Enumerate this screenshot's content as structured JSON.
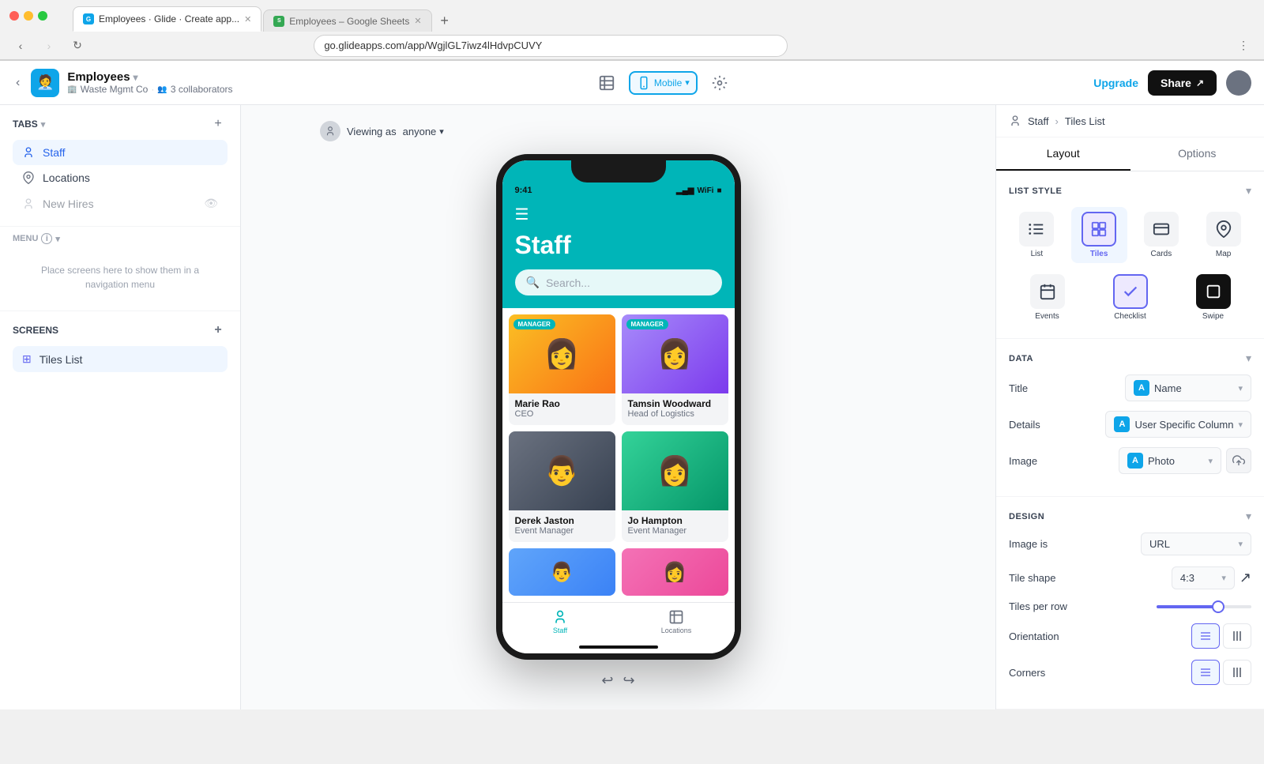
{
  "browser": {
    "tabs": [
      {
        "label": "Employees · Glide · Create app...",
        "type": "glide",
        "active": true
      },
      {
        "label": "Employees – Google Sheets",
        "type": "sheets",
        "active": false
      }
    ],
    "address": "go.glideapps.com/app/WgjlGL7iwz4lHdvpCUVY"
  },
  "header": {
    "app_name": "Employees",
    "app_subtitle_company": "Waste Mgmt Co",
    "app_subtitle_collab": "3 collaborators",
    "upgrade_label": "Upgrade",
    "share_label": "Share"
  },
  "left_sidebar": {
    "tabs_label": "TABS",
    "tabs_items": [
      {
        "label": "Staff",
        "active": true
      },
      {
        "label": "Locations",
        "active": false
      },
      {
        "label": "New Hires",
        "active": false,
        "hidden": true
      }
    ],
    "menu_label": "MENU",
    "menu_placeholder": "Place screens here to show them in a navigation menu",
    "screens_label": "SCREENS",
    "screens_items": [
      {
        "label": "Tiles List",
        "active": true
      }
    ]
  },
  "preview": {
    "viewing_as_label": "Viewing as",
    "viewing_as_value": "anyone",
    "phone": {
      "status_time": "9:41",
      "app_title": "Staff",
      "search_placeholder": "Search...",
      "tiles": [
        {
          "name": "Marie Rao",
          "role": "CEO",
          "badge": "MANAGER",
          "color": "marie"
        },
        {
          "name": "Tamsin Woodward",
          "role": "Head of Logistics",
          "badge": "MANAGER",
          "color": "tamsin"
        },
        {
          "name": "Derek Jaston",
          "role": "Event Manager",
          "badge": null,
          "color": "derek"
        },
        {
          "name": "Jo Hampton",
          "role": "Event Manager",
          "badge": null,
          "color": "jo"
        },
        {
          "name": "",
          "role": "",
          "badge": null,
          "color": "p5"
        },
        {
          "name": "",
          "role": "",
          "badge": null,
          "color": "p6"
        }
      ],
      "bottom_nav": [
        {
          "label": "Staff",
          "active": true
        },
        {
          "label": "Locations",
          "active": false
        }
      ]
    }
  },
  "right_sidebar": {
    "breadcrumb_parent": "Staff",
    "breadcrumb_current": "Tiles List",
    "tabs": [
      "Layout",
      "Options"
    ],
    "active_tab": "Layout",
    "list_style_label": "LIST STYLE",
    "styles": [
      {
        "id": "list",
        "label": "List",
        "icon": "☰"
      },
      {
        "id": "tiles",
        "label": "Tiles",
        "icon": "⊞",
        "selected": true
      },
      {
        "id": "cards",
        "label": "Cards",
        "icon": "▦"
      },
      {
        "id": "map",
        "label": "Map",
        "icon": "📍"
      },
      {
        "id": "events",
        "label": "Events",
        "icon": "📅"
      },
      {
        "id": "checklist",
        "label": "Checklist",
        "icon": "☑"
      },
      {
        "id": "swipe",
        "label": "Swipe",
        "icon": "◧"
      }
    ],
    "data_label": "DATA",
    "data_rows": [
      {
        "label": "Title",
        "value": "Name",
        "icon": "A"
      },
      {
        "label": "Details",
        "value": "User Specific Column",
        "icon": "A"
      },
      {
        "label": "Image",
        "value": "Photo",
        "icon": "A",
        "has_upload": true
      }
    ],
    "design_label": "DESIGN",
    "design_rows": [
      {
        "label": "Image is",
        "value": "URL"
      },
      {
        "label": "Tile shape",
        "value": "4:3"
      },
      {
        "label": "Tiles per row",
        "type": "slider"
      },
      {
        "label": "Orientation",
        "type": "buttons",
        "options": [
          "rows",
          "cols"
        ],
        "active": "rows"
      },
      {
        "label": "Corners",
        "type": "buttons",
        "options": [
          "square",
          "rounded"
        ],
        "active": "rows"
      }
    ]
  }
}
